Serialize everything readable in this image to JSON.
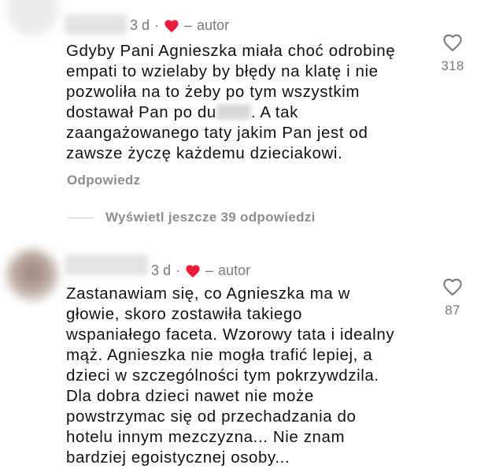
{
  "comments": [
    {
      "time": "3 d",
      "author_label": "autor",
      "lines": [
        "Gdyby Pani Agnieszka miała choć odrobinę",
        "empati to wzielaby by błędy na klatę i nie",
        "pozwoliła na to żeby po tym wszystkim",
        "A tak",
        "zaangażowanego taty jakim Pan jest od",
        "zawsze życzę każdemu dzieciakowi."
      ],
      "line4_prefix": "dostawał Pan po du",
      "likes": "318",
      "reply_label": "Odpowiedz",
      "view_replies_label": "Wyświetl jeszcze 39 odpowiedzi"
    },
    {
      "time": "3 d",
      "author_label": "autor",
      "lines": [
        "Zastanawiam się, co Agnieszka ma w",
        "głowie, skoro zostawiła takiego",
        "wspaniałego faceta. Wzorowy tata i idealny",
        "mąż. Agnieszka nie mogła trafić lepiej, a",
        "dzieci w szczególności tym pokrzywdzila.",
        "Dla dobra dzieci nawet nie może",
        "powstrzymac się od przechadzania do",
        "hotelu innym mezczyzna... Nie znam",
        "bardziej egoistycznej osoby..."
      ],
      "likes": "87"
    }
  ],
  "colors": {
    "heart_red": "#ed1c3a",
    "muted_text": "#7a7a7a",
    "body_text": "#111111"
  },
  "icons": {
    "author_liked": "heart-filled-icon",
    "like": "heart-outline-icon"
  }
}
